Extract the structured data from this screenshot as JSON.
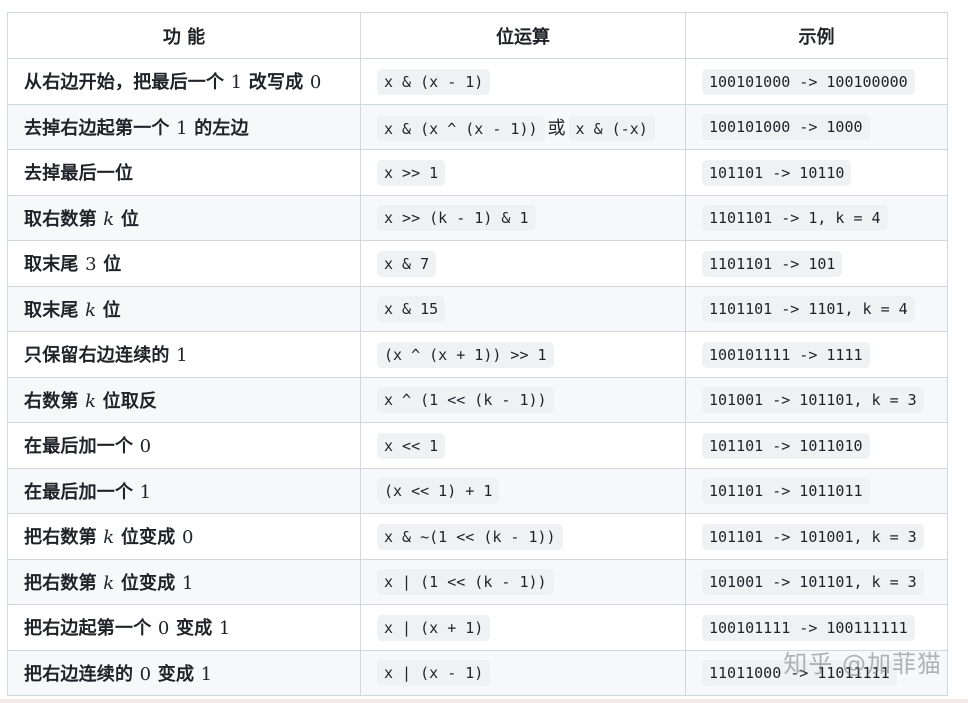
{
  "headers": [
    "功 能",
    "位运算",
    "示例"
  ],
  "rows": [
    {
      "fn": [
        {
          "t": "从右边开始，把最后一个 "
        },
        {
          "m": "1"
        },
        {
          "t": " 改写成 "
        },
        {
          "m": "0"
        }
      ],
      "op": [
        "x & (x - 1)"
      ],
      "ex": "100101000 -> 100100000"
    },
    {
      "fn": [
        {
          "t": "去掉右边起第一个 "
        },
        {
          "m": "1"
        },
        {
          "t": " 的左边"
        }
      ],
      "op": [
        "x & (x ^ (x - 1))",
        "x & (-x)"
      ],
      "ex": "100101000 -> 1000"
    },
    {
      "fn": [
        {
          "t": "去掉最后一位"
        }
      ],
      "op": [
        "x >> 1"
      ],
      "ex": "101101 -> 10110"
    },
    {
      "fn": [
        {
          "t": "取右数第 "
        },
        {
          "m": "k",
          "i": true
        },
        {
          "t": " 位"
        }
      ],
      "op": [
        "x >> (k - 1) & 1"
      ],
      "ex": "1101101 -> 1, k = 4"
    },
    {
      "fn": [
        {
          "t": "取末尾 "
        },
        {
          "m": "3"
        },
        {
          "t": " 位"
        }
      ],
      "op": [
        "x & 7"
      ],
      "ex": "1101101 -> 101"
    },
    {
      "fn": [
        {
          "t": "取末尾 "
        },
        {
          "m": "k",
          "i": true
        },
        {
          "t": " 位"
        }
      ],
      "op": [
        "x & 15"
      ],
      "ex": "1101101 -> 1101, k = 4"
    },
    {
      "fn": [
        {
          "t": "只保留右边连续的 "
        },
        {
          "m": "1"
        }
      ],
      "op": [
        "(x ^ (x + 1)) >> 1"
      ],
      "ex": "100101111 -> 1111"
    },
    {
      "fn": [
        {
          "t": "右数第 "
        },
        {
          "m": "k",
          "i": true
        },
        {
          "t": " 位取反"
        }
      ],
      "op": [
        "x ^ (1 << (k - 1))"
      ],
      "ex": "101001 -> 101101, k = 3"
    },
    {
      "fn": [
        {
          "t": "在最后加一个 "
        },
        {
          "m": "0"
        }
      ],
      "op": [
        "x << 1"
      ],
      "ex": "101101 -> 1011010"
    },
    {
      "fn": [
        {
          "t": "在最后加一个 "
        },
        {
          "m": "1"
        }
      ],
      "op": [
        "(x << 1) + 1"
      ],
      "ex": "101101 -> 1011011"
    },
    {
      "fn": [
        {
          "t": "把右数第 "
        },
        {
          "m": "k",
          "i": true
        },
        {
          "t": " 位变成 "
        },
        {
          "m": "0"
        }
      ],
      "op": [
        "x & ~(1 << (k - 1))"
      ],
      "ex": "101101 -> 101001, k = 3"
    },
    {
      "fn": [
        {
          "t": "把右数第 "
        },
        {
          "m": "k",
          "i": true
        },
        {
          "t": " 位变成 "
        },
        {
          "m": "1"
        }
      ],
      "op": [
        "x | (1 << (k - 1))"
      ],
      "ex": "101001 -> 101101, k = 3"
    },
    {
      "fn": [
        {
          "t": "把右边起第一个 "
        },
        {
          "m": "0"
        },
        {
          "t": " 变成 "
        },
        {
          "m": "1"
        }
      ],
      "op": [
        "x | (x + 1)"
      ],
      "ex": "100101111 -> 100111111"
    },
    {
      "fn": [
        {
          "t": "把右边连续的 "
        },
        {
          "m": "0"
        },
        {
          "t": " 变成 "
        },
        {
          "m": "1"
        }
      ],
      "op": [
        "x | (x - 1)"
      ],
      "ex": "11011000 -> 11011111"
    }
  ],
  "op_separator": "或",
  "watermark": "知乎 @加菲猫"
}
